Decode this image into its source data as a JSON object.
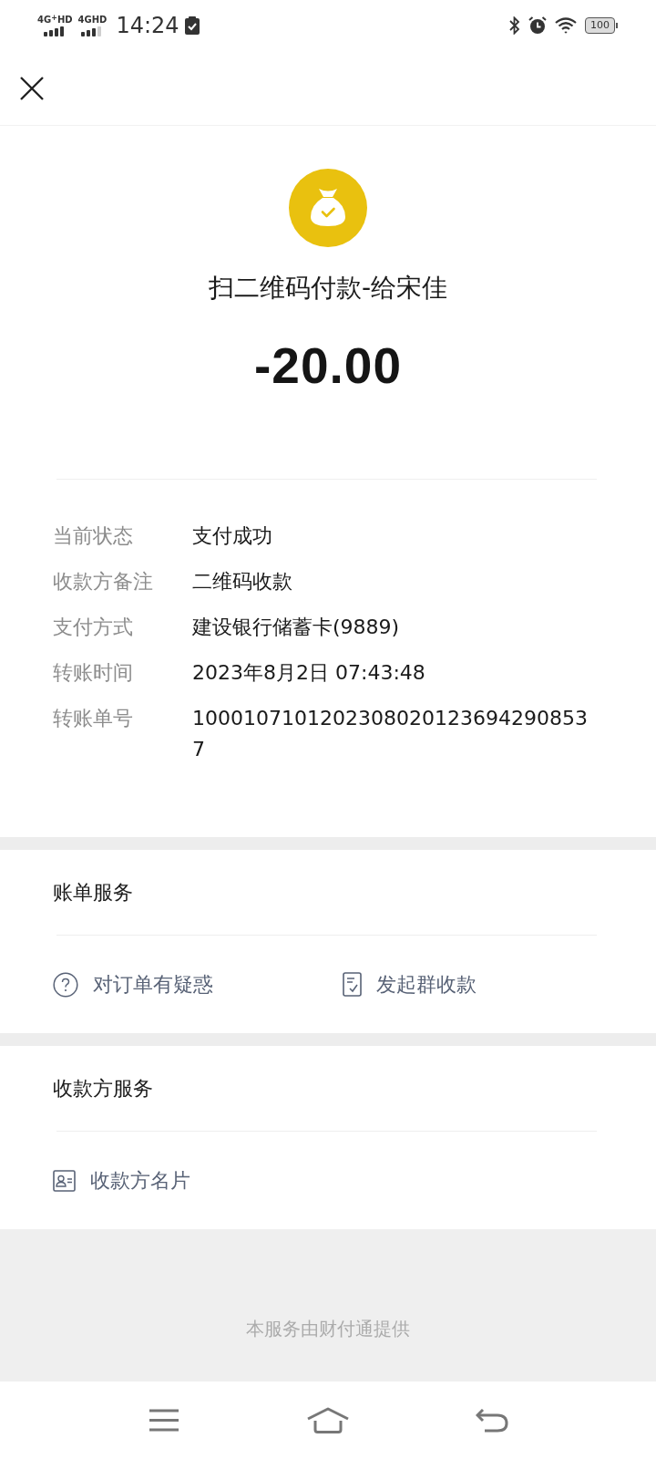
{
  "status_bar": {
    "networks": [
      "4G$^{+}$HD",
      "4GHD"
    ],
    "time": "14:24",
    "battery": "100"
  },
  "payment": {
    "title": "扫二维码付款-给宋佳",
    "amount": "-20.00"
  },
  "details": [
    {
      "label": "当前状态",
      "value": "支付成功"
    },
    {
      "label": "收款方备注",
      "value": "二维码收款"
    },
    {
      "label": "支付方式",
      "value": "建设银行储蓄卡(9889)"
    },
    {
      "label": "转账时间",
      "value": "2023年8月2日 07:43:48"
    },
    {
      "label": "转账单号",
      "value": "10001071012023080201236942908537"
    }
  ],
  "sections": [
    {
      "title": "账单服务",
      "items": [
        {
          "label": "对订单有疑惑",
          "kind": "question"
        },
        {
          "label": "发起群收款",
          "kind": "group-collect"
        }
      ]
    },
    {
      "title": "收款方服务",
      "items": [
        {
          "label": "收款方名片",
          "kind": "card"
        }
      ]
    }
  ],
  "footer": "本服务由财付通提供"
}
